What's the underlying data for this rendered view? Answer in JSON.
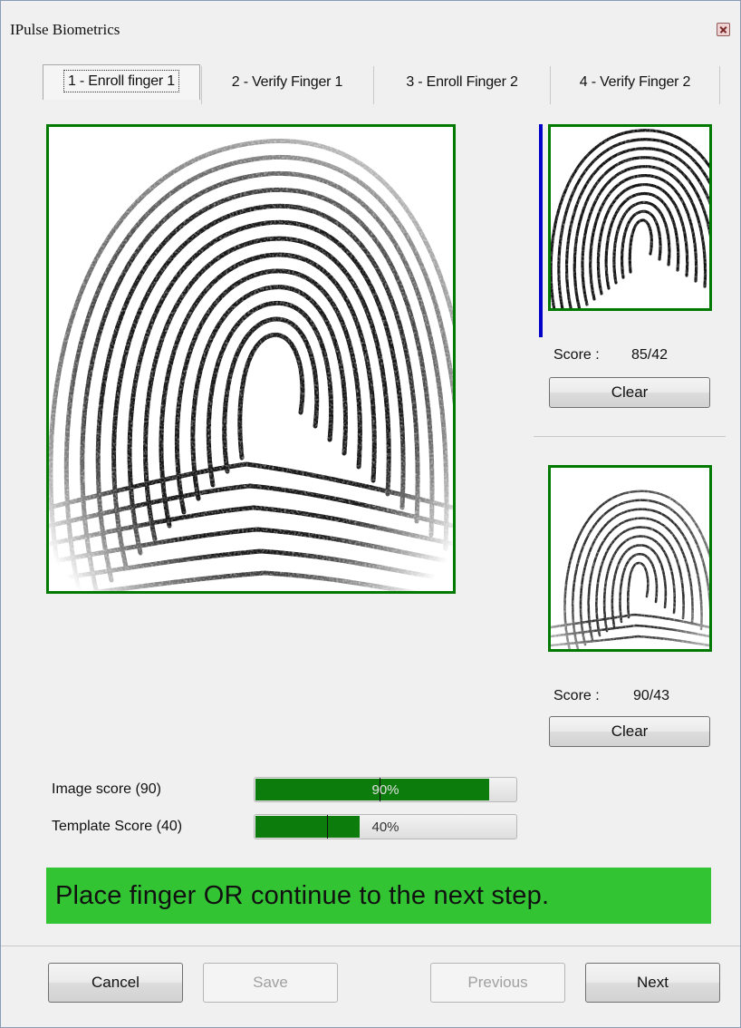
{
  "window": {
    "title": "IPulse Biometrics"
  },
  "tabs": [
    {
      "label": "1 - Enroll finger 1",
      "active": true
    },
    {
      "label": "2 - Verify Finger 1",
      "active": false
    },
    {
      "label": "3 - Enroll Finger 2",
      "active": false
    },
    {
      "label": "4 - Verify Finger 2",
      "active": false
    }
  ],
  "samples": [
    {
      "score_label": "Score :",
      "score_value": "85/42",
      "clear_label": "Clear"
    },
    {
      "score_label": "Score :",
      "score_value": "90/43",
      "clear_label": "Clear"
    }
  ],
  "bars": {
    "image": {
      "label": "Image score (90)",
      "text": "90%",
      "value": 0.9,
      "threshold": 0.48
    },
    "template": {
      "label": "Template Score (40)",
      "text": "40%",
      "value": 0.4,
      "threshold": 0.28
    }
  },
  "status": {
    "message": "Place finger OR continue to the next step.",
    "color": "#33c433"
  },
  "buttons": {
    "cancel": "Cancel",
    "save": "Save",
    "previous": "Previous",
    "next": "Next"
  },
  "colors": {
    "frame_green": "#007a00",
    "progress_green": "#0c7d0c",
    "selection_blue": "#0000c8"
  }
}
